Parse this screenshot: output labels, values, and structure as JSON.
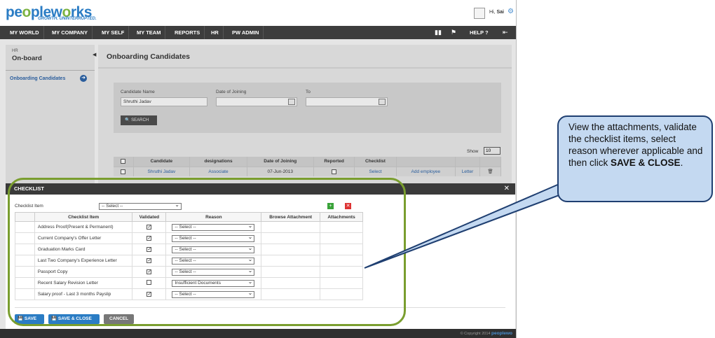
{
  "brand": {
    "logo_a": "pe",
    "logo_b": "o",
    "logo_c": "plew",
    "logo_d": "o",
    "logo_e": "rks",
    "tagline": "GROWTH. UNINTERRUPTED."
  },
  "user": {
    "greeting": "Hi, ",
    "name": "Sai"
  },
  "nav": [
    "MY WORLD",
    "MY COMPANY",
    "MY SELF",
    "MY TEAM",
    "REPORTS",
    "HR",
    "PW ADMIN"
  ],
  "nav_help": "HELP",
  "sidebar": {
    "section": "HR",
    "title": "On-board",
    "items": [
      {
        "label": "Onboarding Candidates"
      }
    ]
  },
  "page": {
    "title": "Onboarding Candidates"
  },
  "search": {
    "candidate_label": "Candidate Name",
    "candidate_value": "Shruthi  Jadav",
    "doj_label": "Date of Joining",
    "to_label": "To",
    "button": "SEARCH"
  },
  "grid": {
    "show_label": "Show",
    "show_value": "10",
    "headers": [
      "Candidate",
      "designations",
      "Date of Joining",
      "Reported",
      "Checklist",
      "",
      ""
    ],
    "rows": [
      {
        "candidate": "Shruthi Jadav",
        "designation": "Associate",
        "doj": "07-Jun-2013",
        "checklist": "Select",
        "action1": "Add employee",
        "action2": "Letter"
      }
    ]
  },
  "modal": {
    "title": "CHECKLIST",
    "checklist_item_label": "Checklist Item",
    "checklist_item_value": "-- Select --",
    "headers": [
      "Checklist Item",
      "Validated",
      "Reason",
      "Browse Attachment",
      "Attachments"
    ],
    "rows": [
      {
        "item": "Address Proof(Present & Permanent)",
        "validated": true,
        "reason": "-- Select --"
      },
      {
        "item": "Current Company's Offer Letter",
        "validated": true,
        "reason": "-- Select --"
      },
      {
        "item": "Graduation Marks Card",
        "validated": true,
        "reason": "-- Select --"
      },
      {
        "item": "Last Two Company's Experience Letter",
        "validated": true,
        "reason": "-- Select --"
      },
      {
        "item": "Passport Copy",
        "validated": true,
        "reason": "-- Select --"
      },
      {
        "item": "Recent Salary Revision Letter",
        "validated": false,
        "reason": "Insufficient Documents"
      },
      {
        "item": "Salary proof - Last 3 months Payslip",
        "validated": true,
        "reason": "-- Select --"
      }
    ],
    "buttons": {
      "save": "SAVE",
      "save_close": "SAVE & CLOSE",
      "cancel": "CANCEL"
    }
  },
  "footer": {
    "copyright": "© Copyright 2014",
    "brand": "peoplewo"
  },
  "callout": {
    "text": "View the attachments, validate the checklist items, select reason wherever applicable and then click ",
    "bold": "SAVE & CLOSE",
    "end": "."
  },
  "colors": {
    "callout_bg": "#c4d9f1",
    "callout_border": "#1f3f71",
    "highlight": "#7a9e2f",
    "nav": "#3d3d3d",
    "link": "#2a5d9c"
  }
}
